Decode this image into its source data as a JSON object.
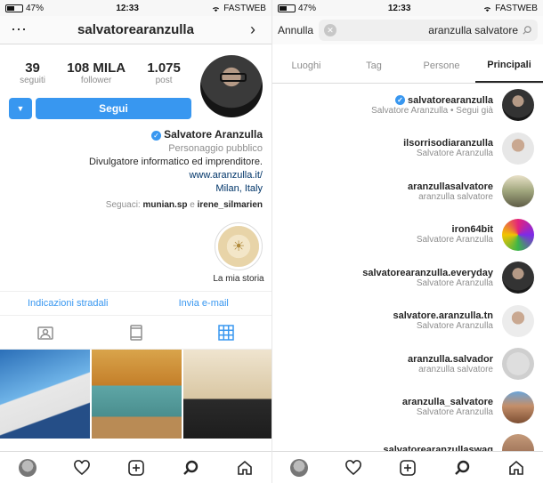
{
  "left": {
    "status": {
      "carrier": "FASTWEB",
      "time": "12:33",
      "battery": "47%"
    },
    "header": {
      "username": "salvatorearanzulla"
    },
    "stats": [
      {
        "value": "39",
        "label": "seguiti"
      },
      {
        "value": "108 MILA",
        "label": "follower"
      },
      {
        "value": "1.075",
        "label": "post"
      }
    ],
    "follow_label": "Segui",
    "bio": {
      "name": "Salvatore Aranzulla",
      "category": "Personaggio pubblico",
      "line1": "Divulgatore informatico ed imprenditore.",
      "website": "www.aranzulla.it/",
      "location": "Milan, Italy",
      "followed_by_prefix": "Seguaci: ",
      "followed_by_1": "munian.sp",
      "followed_by_joiner": " e ",
      "followed_by_2": "irene_silmarien"
    },
    "highlight_label": "La mia storia",
    "actions": {
      "email": "Invia e-mail",
      "directions": "Indicazioni stradali"
    }
  },
  "right": {
    "status": {
      "carrier": "FASTWEB",
      "time": "12:33",
      "battery": "47%"
    },
    "search_value": "aranzulla salvatore",
    "cancel_label": "Annulla",
    "tabs": [
      "Principali",
      "Persone",
      "Tag",
      "Luoghi"
    ],
    "results": [
      {
        "username": "salvatorearanzulla",
        "subtitle": "Salvatore Aranzulla • Segui già"
      },
      {
        "username": "ilsorrisodiaranzulla",
        "subtitle": "Salvatore Aranzulla"
      },
      {
        "username": "aranzullasalvatore",
        "subtitle": "aranzulla salvatore"
      },
      {
        "username": "iron64bit",
        "subtitle": "Salvatore Aranzulla"
      },
      {
        "username": "salvatorearanzulla.everyday",
        "subtitle": "Salvatore Aranzulla"
      },
      {
        "username": "salvatore.aranzulla.tn",
        "subtitle": "Salvatore Aranzulla"
      },
      {
        "username": "aranzulla.salvador",
        "subtitle": "aranzulla salvatore"
      },
      {
        "username": "aranzulla_salvatore",
        "subtitle": "Salvatore Aranzulla"
      },
      {
        "username": "salvatorearanzullaswag",
        "subtitle": ""
      }
    ]
  },
  "icons": [
    "wifi-icon",
    "back-icon",
    "more-icon",
    "grid-icon",
    "igtv-icon",
    "tagged-icon",
    "home-icon",
    "search-icon",
    "add-icon",
    "heart-icon",
    "verified-icon",
    "clear-icon"
  ]
}
